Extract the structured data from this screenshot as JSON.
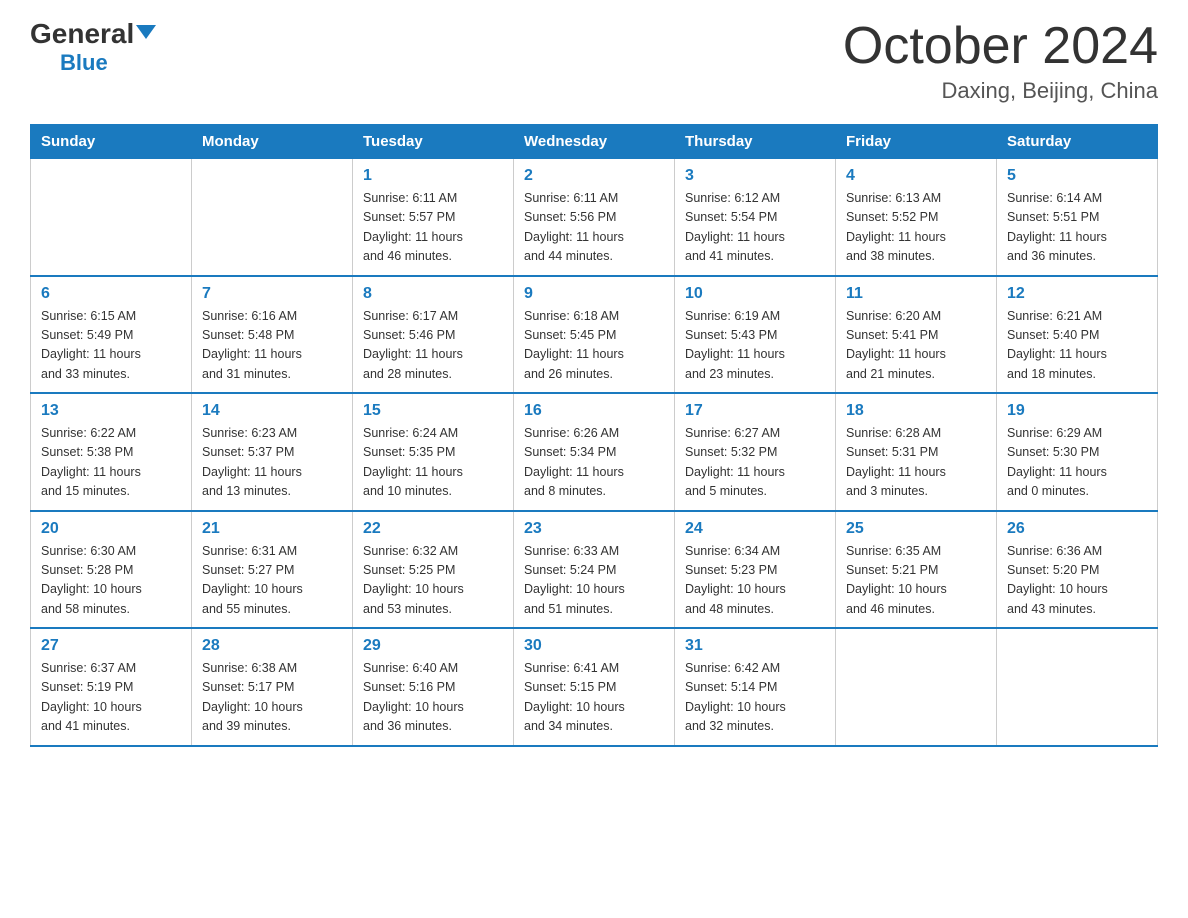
{
  "logo": {
    "general": "General",
    "blue": "Blue"
  },
  "title": "October 2024",
  "subtitle": "Daxing, Beijing, China",
  "headers": [
    "Sunday",
    "Monday",
    "Tuesday",
    "Wednesday",
    "Thursday",
    "Friday",
    "Saturday"
  ],
  "weeks": [
    [
      {
        "day": "",
        "info": ""
      },
      {
        "day": "",
        "info": ""
      },
      {
        "day": "1",
        "info": "Sunrise: 6:11 AM\nSunset: 5:57 PM\nDaylight: 11 hours\nand 46 minutes."
      },
      {
        "day": "2",
        "info": "Sunrise: 6:11 AM\nSunset: 5:56 PM\nDaylight: 11 hours\nand 44 minutes."
      },
      {
        "day": "3",
        "info": "Sunrise: 6:12 AM\nSunset: 5:54 PM\nDaylight: 11 hours\nand 41 minutes."
      },
      {
        "day": "4",
        "info": "Sunrise: 6:13 AM\nSunset: 5:52 PM\nDaylight: 11 hours\nand 38 minutes."
      },
      {
        "day": "5",
        "info": "Sunrise: 6:14 AM\nSunset: 5:51 PM\nDaylight: 11 hours\nand 36 minutes."
      }
    ],
    [
      {
        "day": "6",
        "info": "Sunrise: 6:15 AM\nSunset: 5:49 PM\nDaylight: 11 hours\nand 33 minutes."
      },
      {
        "day": "7",
        "info": "Sunrise: 6:16 AM\nSunset: 5:48 PM\nDaylight: 11 hours\nand 31 minutes."
      },
      {
        "day": "8",
        "info": "Sunrise: 6:17 AM\nSunset: 5:46 PM\nDaylight: 11 hours\nand 28 minutes."
      },
      {
        "day": "9",
        "info": "Sunrise: 6:18 AM\nSunset: 5:45 PM\nDaylight: 11 hours\nand 26 minutes."
      },
      {
        "day": "10",
        "info": "Sunrise: 6:19 AM\nSunset: 5:43 PM\nDaylight: 11 hours\nand 23 minutes."
      },
      {
        "day": "11",
        "info": "Sunrise: 6:20 AM\nSunset: 5:41 PM\nDaylight: 11 hours\nand 21 minutes."
      },
      {
        "day": "12",
        "info": "Sunrise: 6:21 AM\nSunset: 5:40 PM\nDaylight: 11 hours\nand 18 minutes."
      }
    ],
    [
      {
        "day": "13",
        "info": "Sunrise: 6:22 AM\nSunset: 5:38 PM\nDaylight: 11 hours\nand 15 minutes."
      },
      {
        "day": "14",
        "info": "Sunrise: 6:23 AM\nSunset: 5:37 PM\nDaylight: 11 hours\nand 13 minutes."
      },
      {
        "day": "15",
        "info": "Sunrise: 6:24 AM\nSunset: 5:35 PM\nDaylight: 11 hours\nand 10 minutes."
      },
      {
        "day": "16",
        "info": "Sunrise: 6:26 AM\nSunset: 5:34 PM\nDaylight: 11 hours\nand 8 minutes."
      },
      {
        "day": "17",
        "info": "Sunrise: 6:27 AM\nSunset: 5:32 PM\nDaylight: 11 hours\nand 5 minutes."
      },
      {
        "day": "18",
        "info": "Sunrise: 6:28 AM\nSunset: 5:31 PM\nDaylight: 11 hours\nand 3 minutes."
      },
      {
        "day": "19",
        "info": "Sunrise: 6:29 AM\nSunset: 5:30 PM\nDaylight: 11 hours\nand 0 minutes."
      }
    ],
    [
      {
        "day": "20",
        "info": "Sunrise: 6:30 AM\nSunset: 5:28 PM\nDaylight: 10 hours\nand 58 minutes."
      },
      {
        "day": "21",
        "info": "Sunrise: 6:31 AM\nSunset: 5:27 PM\nDaylight: 10 hours\nand 55 minutes."
      },
      {
        "day": "22",
        "info": "Sunrise: 6:32 AM\nSunset: 5:25 PM\nDaylight: 10 hours\nand 53 minutes."
      },
      {
        "day": "23",
        "info": "Sunrise: 6:33 AM\nSunset: 5:24 PM\nDaylight: 10 hours\nand 51 minutes."
      },
      {
        "day": "24",
        "info": "Sunrise: 6:34 AM\nSunset: 5:23 PM\nDaylight: 10 hours\nand 48 minutes."
      },
      {
        "day": "25",
        "info": "Sunrise: 6:35 AM\nSunset: 5:21 PM\nDaylight: 10 hours\nand 46 minutes."
      },
      {
        "day": "26",
        "info": "Sunrise: 6:36 AM\nSunset: 5:20 PM\nDaylight: 10 hours\nand 43 minutes."
      }
    ],
    [
      {
        "day": "27",
        "info": "Sunrise: 6:37 AM\nSunset: 5:19 PM\nDaylight: 10 hours\nand 41 minutes."
      },
      {
        "day": "28",
        "info": "Sunrise: 6:38 AM\nSunset: 5:17 PM\nDaylight: 10 hours\nand 39 minutes."
      },
      {
        "day": "29",
        "info": "Sunrise: 6:40 AM\nSunset: 5:16 PM\nDaylight: 10 hours\nand 36 minutes."
      },
      {
        "day": "30",
        "info": "Sunrise: 6:41 AM\nSunset: 5:15 PM\nDaylight: 10 hours\nand 34 minutes."
      },
      {
        "day": "31",
        "info": "Sunrise: 6:42 AM\nSunset: 5:14 PM\nDaylight: 10 hours\nand 32 minutes."
      },
      {
        "day": "",
        "info": ""
      },
      {
        "day": "",
        "info": ""
      }
    ]
  ]
}
